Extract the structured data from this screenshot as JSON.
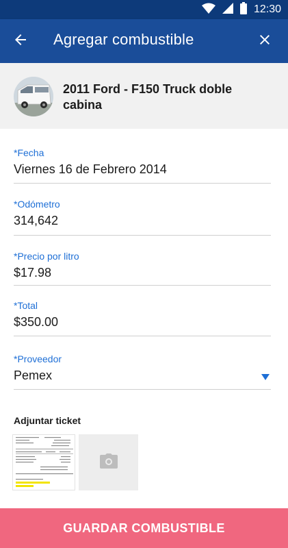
{
  "status_bar": {
    "time": "12:30"
  },
  "app_bar": {
    "title": "Agregar combustible",
    "back_icon": "arrow-left-icon",
    "close_icon": "close-icon",
    "background": "#1a4d99"
  },
  "vehicle": {
    "name": "2011 Ford - F150 Truck doble cabina"
  },
  "form": {
    "fecha": {
      "label": "*Fecha",
      "value": "Viernes 16 de Febrero 2014"
    },
    "odometro": {
      "label": "*Odómetro",
      "value": "314,642"
    },
    "precio": {
      "label": "*Precio por litro",
      "value": "$17.98"
    },
    "total": {
      "label": "*Total",
      "value": "$350.00"
    },
    "proveedor": {
      "label": "*Proveedor",
      "value": "Pemex"
    }
  },
  "attachments": {
    "label": "Adjuntar ticket",
    "add_photo_icon": "camera-icon"
  },
  "save_button": {
    "label": "GUARDAR COMBUSTIBLE",
    "color": "#f0677f"
  },
  "accent_color": "#1e6fd6"
}
